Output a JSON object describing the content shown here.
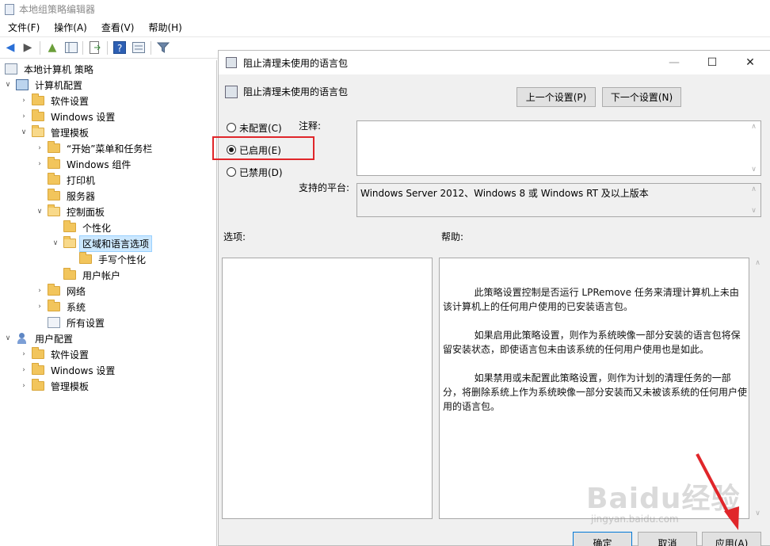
{
  "window": {
    "title": "本地组策略编辑器"
  },
  "menu": [
    "文件(F)",
    "操作(A)",
    "查看(V)",
    "帮助(H)"
  ],
  "toolbar_icons": [
    "back-arrow-icon",
    "forward-arrow-icon",
    "up-folder-icon",
    "show-hide-tree-icon",
    "export-list-icon",
    "help-icon",
    "properties-icon",
    "filter-icon"
  ],
  "tree": {
    "root": "本地计算机 策略",
    "computer_config": "计算机配置",
    "software_settings_1": "软件设置",
    "windows_settings_1": "Windows 设置",
    "admin_templates_1": "管理模板",
    "start_menu": "“开始”菜单和任务栏",
    "windows_components": "Windows 组件",
    "printers": "打印机",
    "server": "服务器",
    "control_panel": "控制面板",
    "personalization": "个性化",
    "regional_language": "区域和语言选项",
    "handwriting": "手写个性化",
    "user_accounts": "用户帐户",
    "network": "网络",
    "system": "系统",
    "all_settings": "所有设置",
    "user_config": "用户配置",
    "software_settings_2": "软件设置",
    "windows_settings_2": "Windows 设置",
    "admin_templates_2": "管理模板"
  },
  "dialog": {
    "title": "阻止清理未使用的语言包",
    "header_title": "阻止清理未使用的语言包",
    "prev_button": "上一个设置(P)",
    "next_button": "下一个设置(N)",
    "radio_not_configured": "未配置(C)",
    "radio_enabled": "已启用(E)",
    "radio_disabled": "已禁用(D)",
    "selected_option": "已启用(E)",
    "comment_label": "注释:",
    "comment_value": "",
    "supported_label": "支持的平台:",
    "supported_value": "Windows Server 2012、Windows 8 或 Windows RT 及以上版本",
    "options_label": "选项:",
    "help_label": "帮助:",
    "help_p1": "此策略设置控制是否运行 LPRemove 任务来清理计算机上未由该计算机上的任何用户使用的已安装语言包。",
    "help_p2": "如果启用此策略设置，则作为系统映像一部分安装的语言包将保留安装状态，即使语言包未由该系统的任何用户使用也是如此。",
    "help_p3": "如果禁用或未配置此策略设置，则作为计划的清理任务的一部分，将删除系统上作为系统映像一部分安装而又未被该系统的任何用户使用的语言包。",
    "ok_button": "确定",
    "cancel_button": "取消",
    "apply_button": "应用(A)"
  },
  "watermark": {
    "brand": "Baidu经验",
    "url": "jingyan.baidu.com"
  },
  "colors": {
    "highlight_box": "#e0262a",
    "annotation_arrow": "#e0262a",
    "selection": "#cce8ff"
  }
}
